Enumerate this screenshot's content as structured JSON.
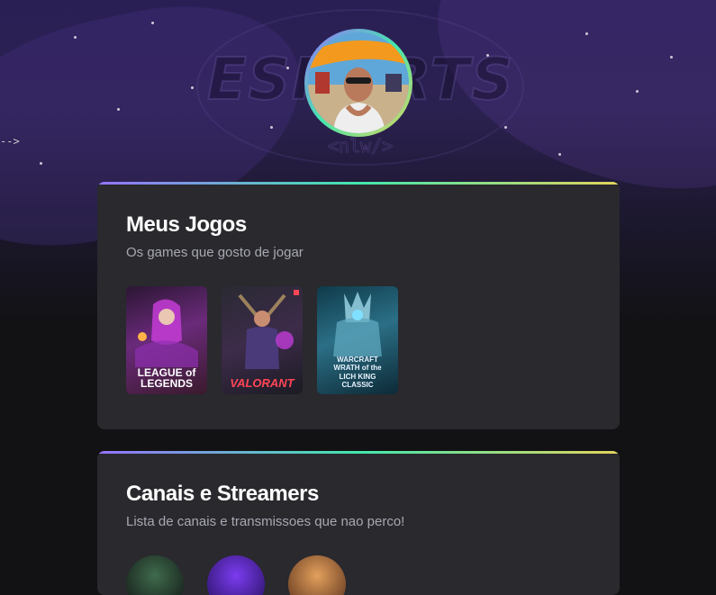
{
  "background": {
    "logo_text": "ESPORTS",
    "logo_sub": "<nlw/>"
  },
  "profile": {
    "avatar_alt": "profile photo"
  },
  "games_section": {
    "title": "Meus Jogos",
    "subtitle": "Os games que gosto de jogar",
    "games": [
      {
        "name": "LEAGUE of LEGENDS",
        "accent": "#b23ad9"
      },
      {
        "name": "VALORANT",
        "accent": "#ff4655"
      },
      {
        "name": "WARCRAFT WRATH of the LICH KING CLASSIC",
        "accent": "#4fb3d9"
      }
    ]
  },
  "channels_section": {
    "title": "Canais e Streamers",
    "subtitle": "Lista de canais e transmissoes que nao perco!"
  },
  "colors": {
    "page_bg": "#121214",
    "card_bg": "#29292e",
    "gradient": [
      "#9572fc",
      "#43e7ad",
      "#e2d45c"
    ]
  }
}
